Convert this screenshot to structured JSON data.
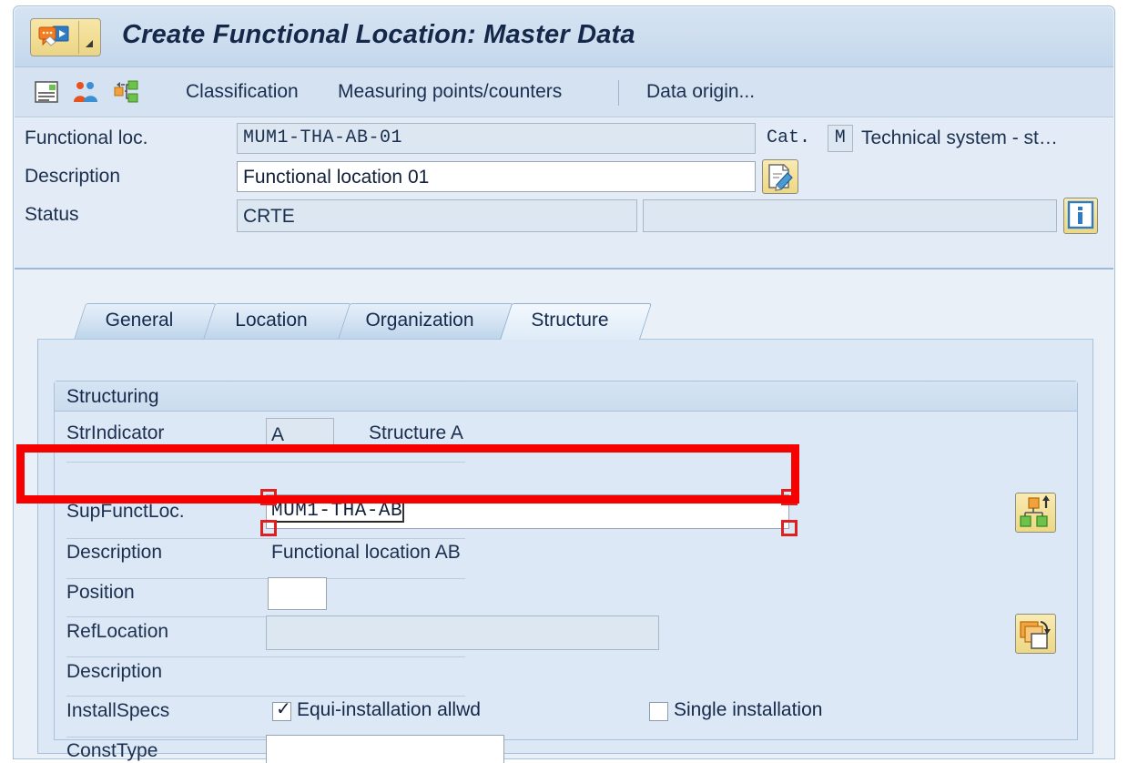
{
  "window": {
    "title": "Create Functional Location: Master Data",
    "system_button_icon": "sap-system-menu-icon",
    "dropdown_arrow_icon": "dropdown-arrow-icon"
  },
  "toolbar": {
    "icons": [
      {
        "name": "list-overview-icon",
        "label": ""
      },
      {
        "name": "partners-icon",
        "label": ""
      },
      {
        "name": "structure-hierarchy-icon",
        "label": ""
      }
    ],
    "buttons": [
      {
        "label": "Classification"
      },
      {
        "label": "Measuring points/counters"
      },
      {
        "label": "Data origin..."
      }
    ]
  },
  "header": {
    "functional_loc": {
      "label": "Functional loc.",
      "value": "MUM1-THA-AB-01",
      "placeholder": ""
    },
    "category": {
      "label": "Cat.",
      "value": "M",
      "text": "Technical system - st…"
    },
    "description": {
      "label": "Description",
      "value": "Functional location 01",
      "placeholder": "",
      "edit_icon": "long-text-edit-icon"
    },
    "status": {
      "label": "Status",
      "value": "CRTE",
      "extra_value": "",
      "info_icon": "info-icon"
    }
  },
  "tabs": [
    {
      "label": "General",
      "active": false
    },
    {
      "label": "Location",
      "active": false
    },
    {
      "label": "Organization",
      "active": false
    },
    {
      "label": "Structure",
      "active": true
    }
  ],
  "structure_tab": {
    "group_title": "Structuring",
    "fields": {
      "str_indicator": {
        "label": "StrIndicator",
        "value": "A",
        "text": "Structure A"
      },
      "sup_funct_loc": {
        "label": "SupFunctLoc.",
        "value": "MUM1-THA-AB",
        "focused": true,
        "structure_icon": "structure-list-up-icon"
      },
      "sup_description": {
        "label": "Description",
        "value": "Functional location AB"
      },
      "position": {
        "label": "Position",
        "value": ""
      },
      "ref_location": {
        "label": "RefLocation",
        "value": "",
        "copy_icon": "copy-reference-icon"
      },
      "ref_description": {
        "label": "Description",
        "value": ""
      },
      "install_specs": {
        "label": "InstallSpecs",
        "checkbox_1": {
          "label": "Equi-installation allwd",
          "checked": true
        },
        "checkbox_2": {
          "label": "Single installation",
          "checked": false
        }
      },
      "const_type": {
        "label": "ConstType",
        "value": ""
      }
    }
  },
  "annotation": {
    "name": "highlight-rectangle",
    "color": "#f60000",
    "targets": "SupFunctLoc. field row"
  }
}
